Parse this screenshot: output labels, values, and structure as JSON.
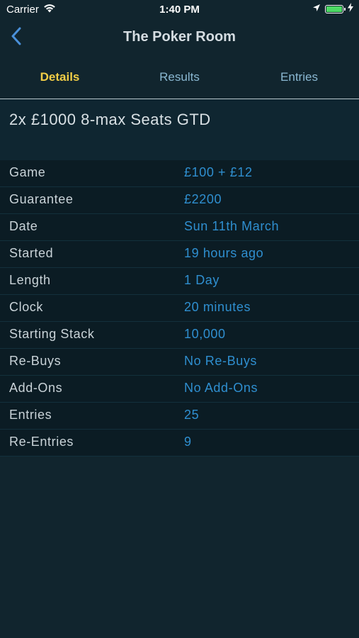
{
  "status_bar": {
    "carrier": "Carrier",
    "time": "1:40 PM",
    "battery_level": 1.0,
    "battery_color": "#4cd964"
  },
  "nav": {
    "back_icon": "chevron-left-icon",
    "title": "The Poker Room"
  },
  "tabs": [
    {
      "label": "Details",
      "active": true
    },
    {
      "label": "Results",
      "active": false
    },
    {
      "label": "Entries",
      "active": false
    }
  ],
  "tournament": {
    "title": "2x £1000 8-max Seats GTD"
  },
  "details": [
    {
      "label": "Game",
      "value": "£100 + £12"
    },
    {
      "label": "Guarantee",
      "value": "£2200"
    },
    {
      "label": "Date",
      "value": "Sun 11th March"
    },
    {
      "label": "Started",
      "value": "19 hours ago"
    },
    {
      "label": "Length",
      "value": "1 Day"
    },
    {
      "label": "Clock",
      "value": "20 minutes"
    },
    {
      "label": "Starting Stack",
      "value": "10,000"
    },
    {
      "label": "Re-Buys",
      "value": "No Re-Buys"
    },
    {
      "label": "Add-Ons",
      "value": "No Add-Ons"
    },
    {
      "label": "Entries",
      "value": "25"
    },
    {
      "label": "Re-Entries",
      "value": "9"
    }
  ],
  "colors": {
    "background": "#11252e",
    "active_tab": "#f1cd46",
    "inactive_tab": "#8ab8d2",
    "value_text": "#2f8fd0",
    "back_chevron": "#4a90d9"
  }
}
